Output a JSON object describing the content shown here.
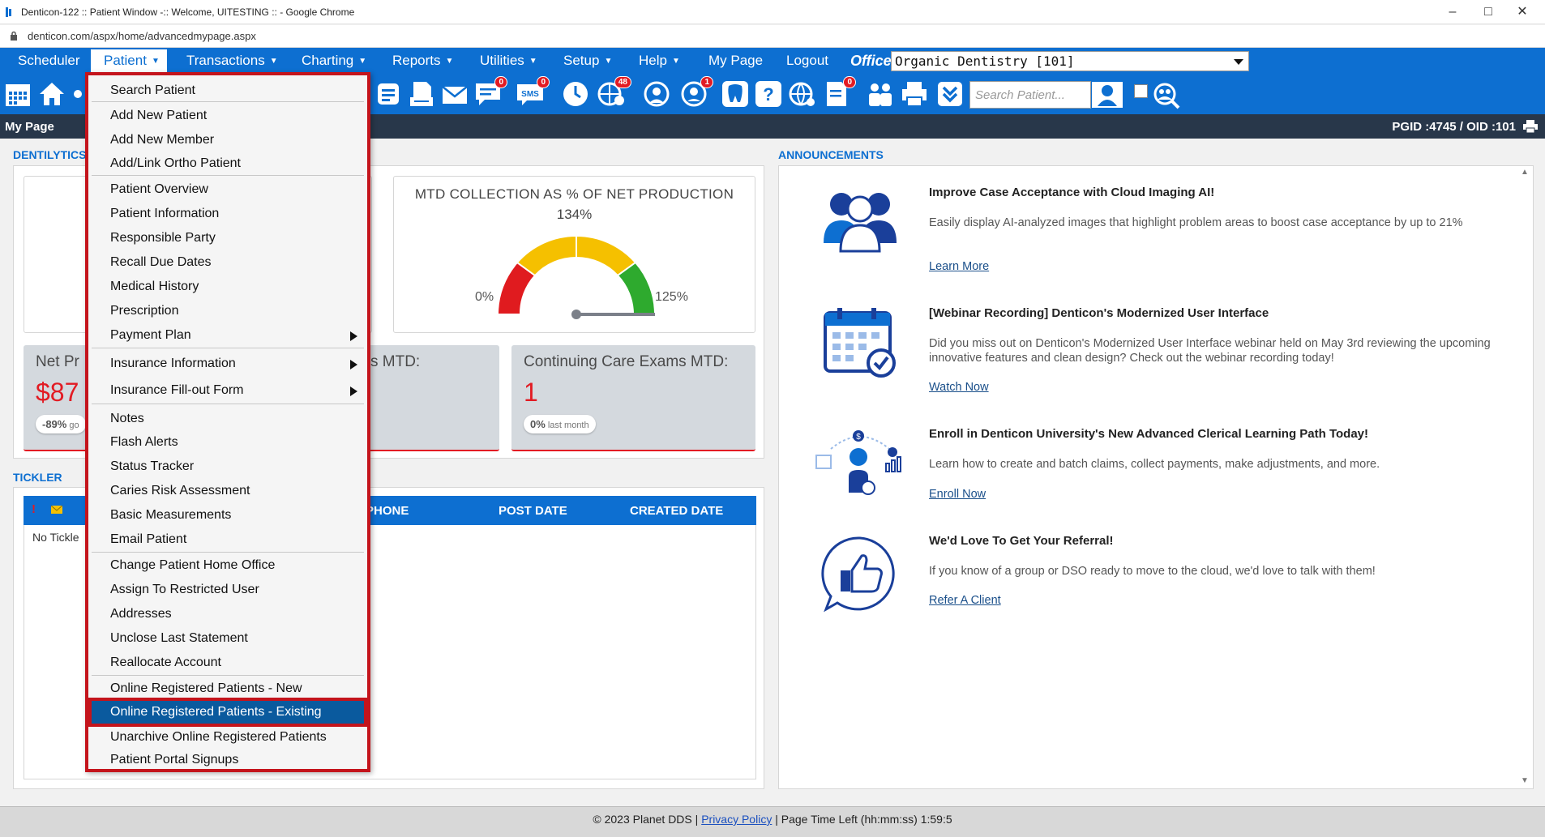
{
  "window": {
    "title": "Denticon-122 :: Patient Window -:: Welcome, UITESTING :: - Google Chrome",
    "url": "denticon.com/aspx/home/advancedmypage.aspx"
  },
  "menu": {
    "items": [
      "Scheduler",
      "Patient",
      "Transactions",
      "Charting",
      "Reports",
      "Utilities",
      "Setup",
      "Help",
      "My Page",
      "Logout"
    ],
    "office_label": "Office",
    "office_value": "Organic Dentistry [101]"
  },
  "toolbar": {
    "search_placeholder": "Search Patient...",
    "badges": {
      "messages": "0",
      "sms": "0",
      "web": "48",
      "alerts": "1",
      "forms": "0"
    }
  },
  "subheader": {
    "label": "My Page",
    "ids": "PGID :4745  /  OID :101"
  },
  "dentilytics": {
    "title": "DENTILYTICS",
    "gauge": {
      "title": "MTD COLLECTION AS % OF NET PRODUCTION",
      "value": "134%",
      "min": "0%",
      "max": "125%",
      "value_numeric": 134,
      "max_numeric": 125
    },
    "cards": [
      {
        "title": "Net Pr",
        "value": "$87",
        "pill_pct": "-89%",
        "pill_text": "go"
      },
      {
        "title": "s MTD:",
        "value": "",
        "pill_pct": "",
        "pill_text": ""
      },
      {
        "title": "Continuing Care Exams MTD:",
        "value": "1",
        "pill_pct": "0%",
        "pill_text": "last month"
      }
    ]
  },
  "tickler": {
    "title": "TICKLER",
    "columns": [
      "PHONE",
      "POST DATE",
      "CREATED DATE"
    ],
    "empty_text": "No Tickle"
  },
  "announcements": {
    "title": "ANNOUNCEMENTS",
    "items": [
      {
        "title": "Improve Case Acceptance with Cloud Imaging AI!",
        "desc": "Easily display AI-analyzed images that highlight problem areas to boost case acceptance by up to 21%",
        "link": "Learn More"
      },
      {
        "title": "[Webinar Recording] Denticon's Modernized User Interface",
        "desc": "Did you miss out on Denticon's Modernized User Interface webinar held on May 3rd reviewing the upcoming innovative features and clean design? Check out the webinar recording today!",
        "link": "Watch Now"
      },
      {
        "title": "Enroll in Denticon University's New Advanced Clerical Learning Path Today!",
        "desc": "Learn how to create and batch claims, collect payments, make adjustments, and more.",
        "link": "Enroll Now"
      },
      {
        "title": "We'd Love To Get Your Referral!",
        "desc": "If you know of a group or DSO ready to move to the cloud, we'd love to talk with them!",
        "link": "Refer A Client"
      }
    ]
  },
  "dropdown": {
    "items": [
      "Search Patient",
      "Add New Patient",
      "Add New Member",
      "Add/Link Ortho Patient",
      "Patient Overview",
      "Patient Information",
      "Responsible Party",
      "Recall Due Dates",
      "Medical History",
      "Prescription",
      "Payment Plan",
      "Insurance Information",
      "Insurance Fill-out Form",
      "Notes",
      "Flash Alerts",
      "Status Tracker",
      "Caries Risk Assessment",
      "Basic Measurements",
      "Email Patient",
      "Change Patient Home Office",
      "Assign To Restricted User",
      "Addresses",
      "Unclose Last Statement",
      "Reallocate Account",
      "Online Registered Patients - New",
      "Online Registered Patients - Existing",
      "Unarchive Online Registered Patients",
      "Patient Portal Signups"
    ]
  },
  "footer": {
    "copyright": "© 2023 Planet DDS |",
    "privacy": "Privacy Policy",
    "time_left": "|  Page Time Left (hh:mm:ss) 1:59:5"
  }
}
